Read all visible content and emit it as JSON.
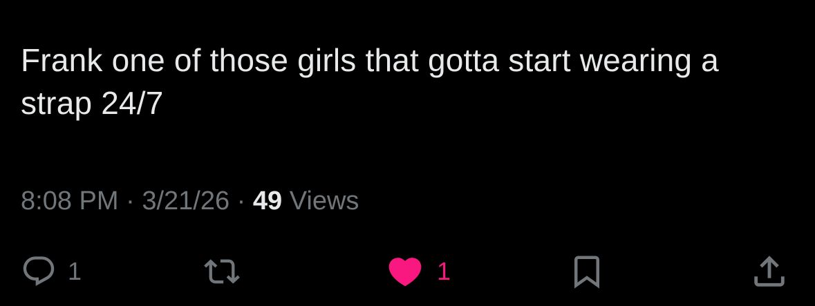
{
  "tweet": {
    "text": "Frank one of those girls that gotta start wearing a strap 24/7"
  },
  "meta": {
    "time": "8:08 PM",
    "separator": " · ",
    "date": "3/21/26",
    "views_count": "49",
    "views_label": "Views"
  },
  "actions": {
    "reply_count": "1",
    "like_count": "1",
    "icons": [
      "reply-icon",
      "retweet-icon",
      "heart-icon",
      "bookmark-icon",
      "share-icon"
    ]
  },
  "colors": {
    "background": "#000000",
    "text": "#e7e9ea",
    "muted": "#71767b",
    "like": "#f91880"
  }
}
